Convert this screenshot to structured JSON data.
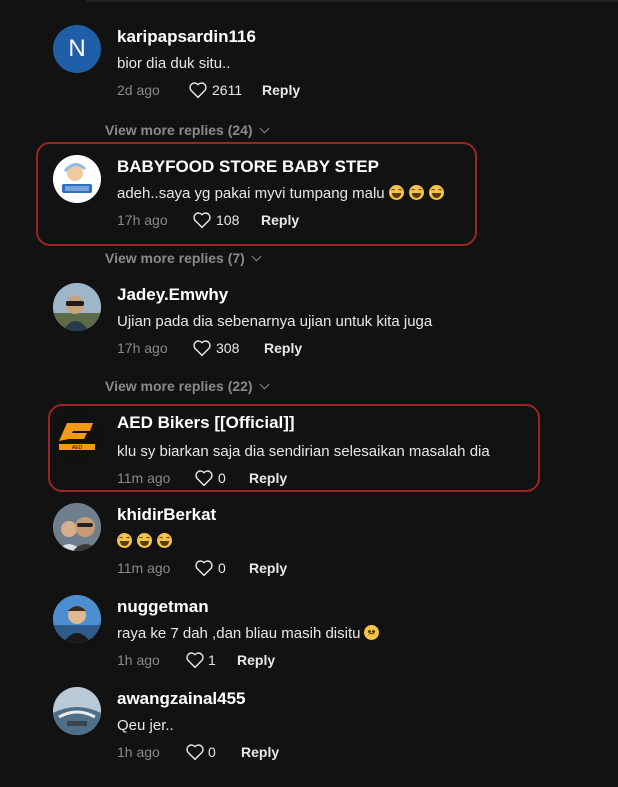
{
  "comments": [
    {
      "username": "karipapsardin116",
      "text": "bior dia duk situ..",
      "time": "2d ago",
      "likes": "2611",
      "reply_label": "Reply",
      "avatar_letter": "N",
      "avatar_color": "#1f5fa8"
    },
    {
      "username": "BABYFOOD STORE BABY STEP",
      "text": "adeh..saya yg pakai myvi tumpang malu",
      "time": "17h ago",
      "likes": "108",
      "reply_label": "Reply",
      "avatar_logo_text": "BABY STEP",
      "emoji_count": 3
    },
    {
      "username": "Jadey.Emwhy",
      "text": "Ujian pada dia sebenarnya ujian untuk kita juga",
      "time": "17h ago",
      "likes": "308",
      "reply_label": "Reply"
    },
    {
      "username": "AED Bikers [[Official]]",
      "text": "klu sy biarkan saja dia sendirian selesaikan masalah dia",
      "time": "11m ago",
      "likes": "0",
      "reply_label": "Reply",
      "avatar_color": "#f29a12"
    },
    {
      "username": "khidirBerkat",
      "text": "",
      "time": "11m ago",
      "likes": "0",
      "reply_label": "Reply",
      "emoji_count": 3
    },
    {
      "username": "nuggetman",
      "text": "raya ke 7 dah ,dan bliau masih disitu",
      "time": "1h ago",
      "likes": "1",
      "reply_label": "Reply",
      "emoji": "sad-face"
    },
    {
      "username": "awangzainal455",
      "text": "Qeu jer..",
      "time": "1h ago",
      "likes": "0",
      "reply_label": "Reply"
    }
  ],
  "view_more": [
    {
      "label": "View more replies (24)"
    },
    {
      "label": "View more replies (7)"
    },
    {
      "label": "View more replies (22)"
    }
  ],
  "colors": {
    "background": "#121212",
    "highlight": "#9b2424",
    "muted": "#8a8a8a"
  },
  "icons": {
    "like": "heart-outline-icon",
    "expand": "chevron-down-icon"
  }
}
